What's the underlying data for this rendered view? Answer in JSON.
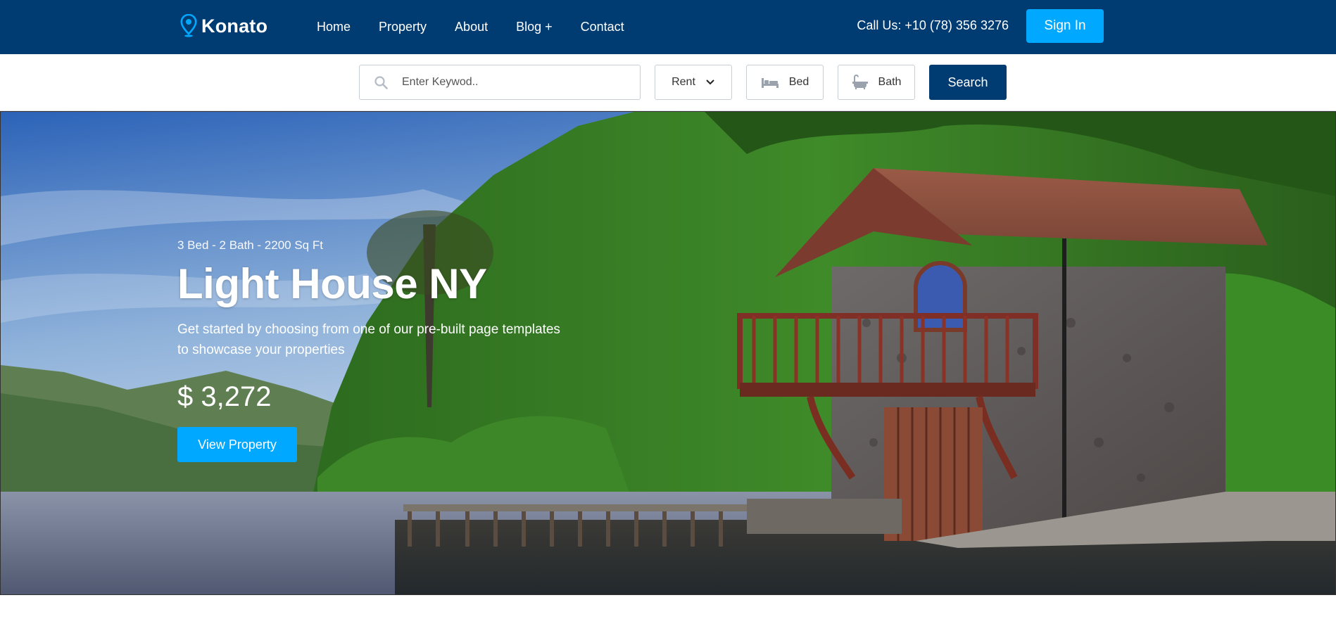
{
  "brand": {
    "name": "Konato",
    "accent": "#00a8ff",
    "navy": "#003c71"
  },
  "nav": {
    "items": [
      {
        "label": "Home"
      },
      {
        "label": "Property"
      },
      {
        "label": "About"
      },
      {
        "label": "Blog +"
      },
      {
        "label": "Contact"
      }
    ],
    "call_text": "Call Us: +10 (78) 356 3276",
    "sign_in": "Sign In"
  },
  "search": {
    "keyword_placeholder": "Enter Keywod..",
    "type_selected": "Rent",
    "bed_label": "Bed",
    "bath_label": "Bath",
    "button": "Search"
  },
  "hero": {
    "meta": "3 Bed - 2 Bath - 2200 Sq Ft",
    "title": "Light House NY",
    "description": "Get started by choosing from one of our pre-built page templates to showcase your properties",
    "price": "$ 3,272",
    "cta": "View Property"
  }
}
